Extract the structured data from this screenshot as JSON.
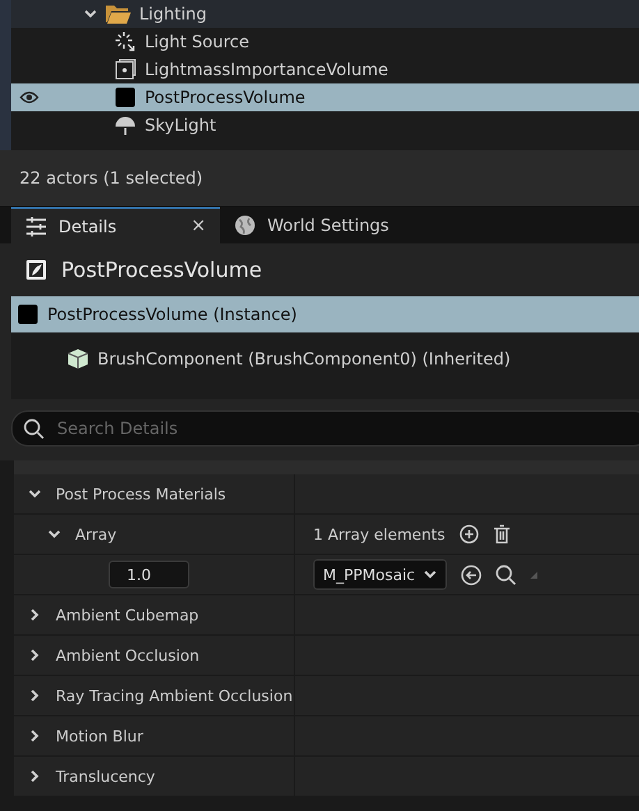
{
  "outliner": {
    "folder": {
      "label": "Lighting",
      "expanded": true
    },
    "items": [
      {
        "label": "Light Source",
        "kind": "light",
        "selected": false
      },
      {
        "label": "LightmassImportanceVolume",
        "kind": "volume",
        "selected": false
      },
      {
        "label": "PostProcessVolume",
        "kind": "postprocess",
        "selected": true
      },
      {
        "label": "SkyLight",
        "kind": "skylight",
        "selected": false
      }
    ]
  },
  "status_bar": "22 actors (1 selected)",
  "tabs": [
    {
      "label": "Details",
      "kind": "details",
      "selected": true,
      "close": "×"
    },
    {
      "label": "World Settings",
      "kind": "world",
      "selected": false
    }
  ],
  "details": {
    "title": "PostProcessVolume",
    "components": [
      {
        "label": "PostProcessVolume (Instance)",
        "kind": "postprocess",
        "selected": true,
        "children": [
          {
            "label": "BrushComponent (BrushComponent0) (Inherited)",
            "kind": "brush",
            "selected": false
          }
        ]
      }
    ],
    "search": {
      "placeholder": "Search Details"
    },
    "properties": [
      {
        "kind": "group",
        "label": "Post Process Materials",
        "expanded": true,
        "children": [
          {
            "kind": "array",
            "label": "Array",
            "expanded": true,
            "value": "1 Array elements",
            "children": [
              {
                "kind": "element",
                "weight": "1.0",
                "asset": "M_PPMosaic"
              }
            ]
          }
        ]
      },
      {
        "kind": "group",
        "label": "Ambient Cubemap",
        "expanded": false
      },
      {
        "kind": "group",
        "label": "Ambient Occlusion",
        "expanded": false
      },
      {
        "kind": "group",
        "label": "Ray Tracing Ambient Occlusion",
        "expanded": false
      },
      {
        "kind": "group",
        "label": "Motion Blur",
        "expanded": false
      },
      {
        "kind": "group",
        "label": "Translucency",
        "expanded": false
      }
    ]
  }
}
